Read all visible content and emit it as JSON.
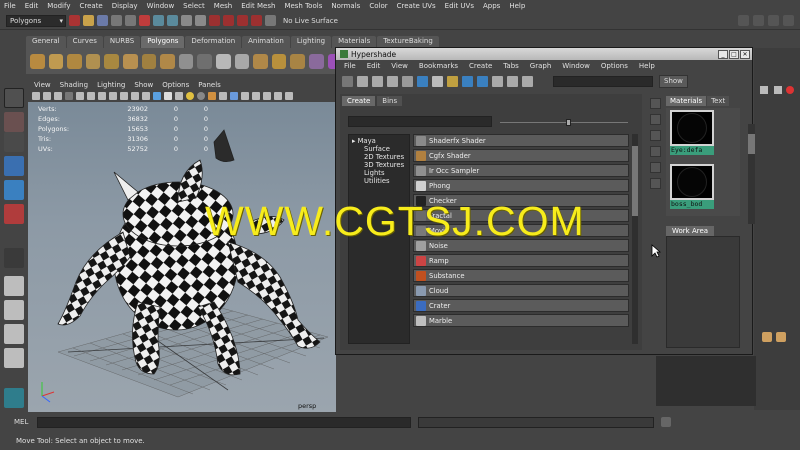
{
  "menubar": [
    "File",
    "Edit",
    "Modify",
    "Create",
    "Display",
    "Window",
    "Select",
    "Mesh",
    "Edit Mesh",
    "Mesh Tools",
    "Normals",
    "Color",
    "Create UVs",
    "Edit UVs",
    "Apps",
    "Help"
  ],
  "status": {
    "mode": "Polygons",
    "live_surface": "No Live Surface"
  },
  "shelf_tabs": [
    "General",
    "Curves",
    "NURBS",
    "Polygons",
    "Deformation",
    "Animation",
    "Lighting",
    "Materials",
    "TextureBaking"
  ],
  "shelf_active": "Polygons",
  "viewport": {
    "menu": [
      "View",
      "Shading",
      "Lighting",
      "Show",
      "Options",
      "Panels"
    ],
    "camera": "persp",
    "hud": [
      {
        "label": "Verts:",
        "v1": "23902",
        "v2": "0",
        "v3": "0"
      },
      {
        "label": "Edges:",
        "v1": "36832",
        "v2": "0",
        "v3": "0"
      },
      {
        "label": "Polygons:",
        "v1": "15653",
        "v2": "0",
        "v3": "0"
      },
      {
        "label": "Tris:",
        "v1": "31306",
        "v2": "0",
        "v3": "0"
      },
      {
        "label": "UVs:",
        "v1": "52752",
        "v2": "0",
        "v3": "0"
      }
    ]
  },
  "hypershade": {
    "title": "Hypershade",
    "menu": [
      "File",
      "Edit",
      "View",
      "Bookmarks",
      "Create",
      "Tabs",
      "Graph",
      "Window",
      "Options",
      "Help"
    ],
    "show_button": "Show",
    "tabs": [
      "Create",
      "Bins"
    ],
    "tree": {
      "root": "Maya",
      "children": [
        "Surface",
        "2D Textures",
        "3D Textures",
        "Lights",
        "Utilities"
      ]
    },
    "nodes": [
      {
        "label": "Shaderfx Shader",
        "color": "#8a8a8a"
      },
      {
        "label": "Cgfx Shader",
        "color": "#b08040"
      },
      {
        "label": "Ir Occ Sampler",
        "color": "#909090"
      },
      {
        "label": "Phong",
        "color": "#d0d0d0"
      },
      {
        "label": "Checker",
        "color": "#222222"
      },
      {
        "label": "Fractal",
        "color": "#6a6a6a"
      },
      {
        "label": "Movie",
        "color": "#7a7a7a"
      },
      {
        "label": "Noise",
        "color": "#a0a0a0"
      },
      {
        "label": "Ramp",
        "color": "#cc4444"
      },
      {
        "label": "Substance",
        "color": "#c05020"
      },
      {
        "label": "Cloud",
        "color": "#8a9ab0"
      },
      {
        "label": "Crater",
        "color": "#3b6cc0"
      },
      {
        "label": "Marble",
        "color": "#bfbfbf"
      }
    ],
    "materials_tabs": [
      "Materials",
      "Text"
    ],
    "materials": [
      "Eye:defa",
      "boss_bod"
    ],
    "work_area_tab": "Work Area"
  },
  "command": {
    "label": "MEL"
  },
  "helpline": "Move Tool: Select an object to move.",
  "watermark": "WWW.CGTSJ.COM"
}
